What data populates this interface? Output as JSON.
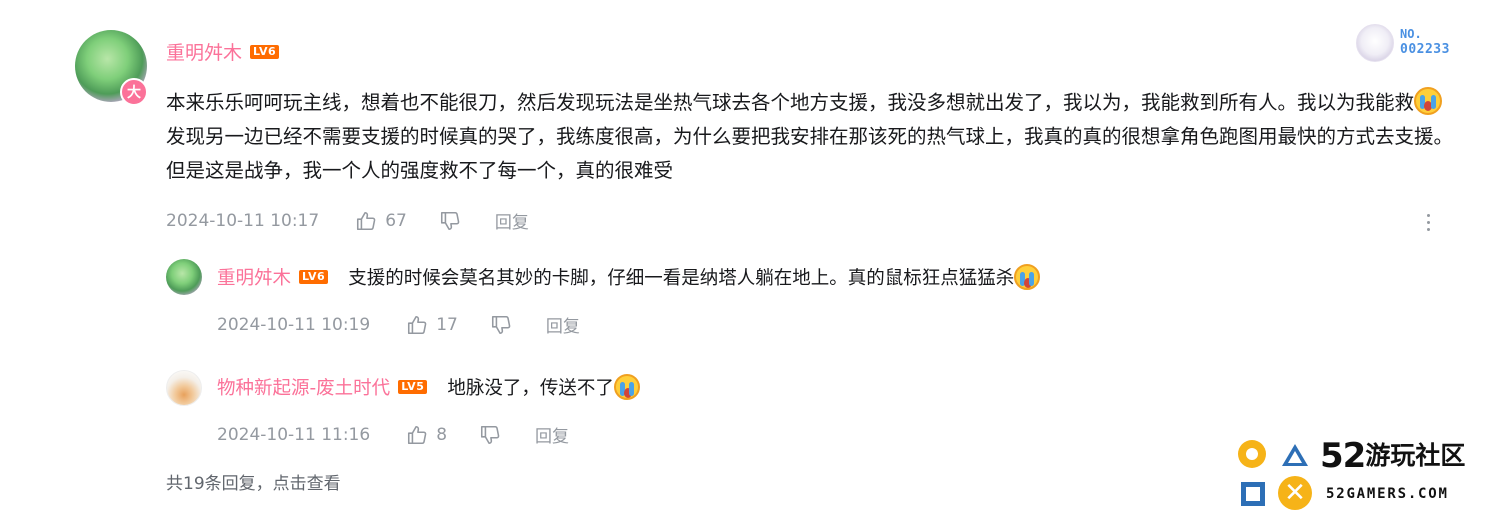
{
  "main_comment": {
    "username": "重明舛木",
    "level": "LV6",
    "badge_char": "大",
    "text_part1": "本来乐乐呵呵玩主线，想着也不能很刀，然后发现玩法是坐热气球去各个地方支援，我没多想就出发了，我以为，我能救到所有人。我以为我能救",
    "text_part2": "发现另一边已经不需要支援的时候真的哭了，我练度很高，为什么要把我安排在那该死的热气球上，我真的真的很想拿角色跑图用最快的方式去支援。但是这是战争，我一个人的强度救不了每一个，真的很难受",
    "time": "2024-10-11 10:17",
    "likes": "67",
    "reply_label": "回复"
  },
  "nameplate": {
    "label": "NO.",
    "number": "002233"
  },
  "replies": [
    {
      "username": "重明舛木",
      "level": "LV6",
      "text": "支援的时候会莫名其妙的卡脚，仔细一看是纳塔人躺在地上。真的鼠标狂点猛猛杀",
      "time": "2024-10-11 10:19",
      "likes": "17",
      "reply_label": "回复"
    },
    {
      "username": "物种新起源-废土时代",
      "level": "LV5",
      "text": "地脉没了，传送不了",
      "time": "2024-10-11 11:16",
      "likes": "8",
      "reply_label": "回复"
    }
  ],
  "see_more": "共19条回复，点击查看",
  "watermark": {
    "number": "52",
    "name": "游玩社区",
    "domain": "52GAMERS.COM"
  },
  "colors": {
    "username": "#fb7299",
    "meta": "#9499a0",
    "level_badge": "#ff6c00"
  }
}
